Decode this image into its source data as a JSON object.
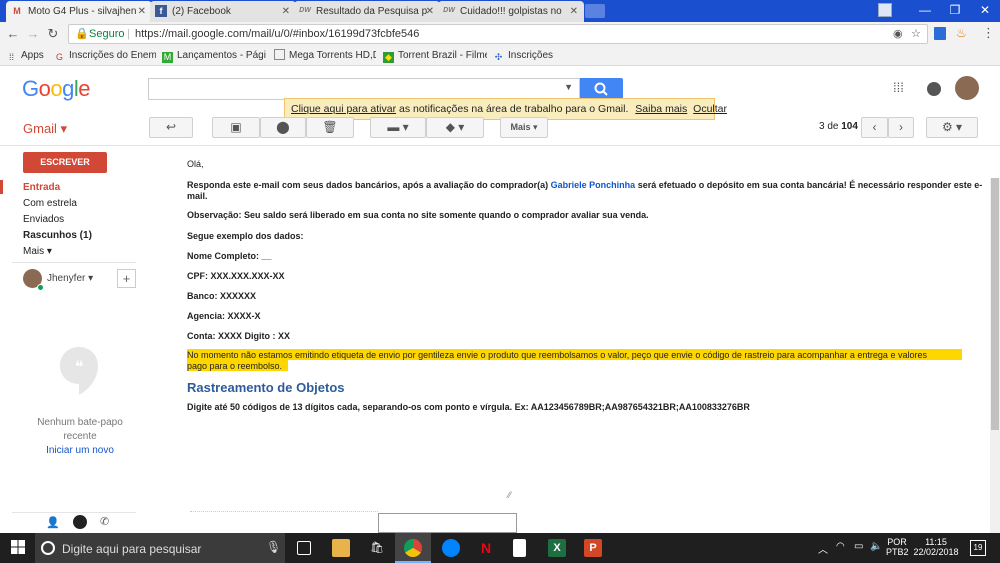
{
  "browser": {
    "tabs": [
      {
        "label": "Moto G4 Plus - silvajhen",
        "icon": "M"
      },
      {
        "label": "(2) Facebook",
        "icon": "f"
      },
      {
        "label": "Resultado da Pesquisa p",
        "icon": "DW"
      },
      {
        "label": "Cuidado!!! golpistas no",
        "icon": "DW"
      }
    ],
    "secure_label": "Seguro",
    "url": "https://mail.google.com/mail/u/0/#inbox/16199d73fcbfe546",
    "bookmarks": [
      {
        "label": "Apps"
      },
      {
        "label": "Inscrições do Enem 2"
      },
      {
        "label": "Lançamentos - Págin"
      },
      {
        "label": "Mega Torrents HD,Do"
      },
      {
        "label": "Torrent Brazil - Filme"
      },
      {
        "label": "Inscrições"
      }
    ]
  },
  "gmail": {
    "logo": "Google",
    "product": "Gmail ▾",
    "notification": {
      "link_text": "Clique aqui para ativar",
      "rest_text": "as notificações na área de trabalho para o Gmail.",
      "learn_more": "Saiba mais",
      "hide": "Ocultar"
    },
    "toolbar": {
      "more_label": "Mais ▾"
    },
    "pagination": {
      "current": "3",
      "of": "de",
      "total": "104"
    },
    "sidebar": {
      "compose": "ESCREVER",
      "items": [
        {
          "label": "Entrada"
        },
        {
          "label": "Com estrela"
        },
        {
          "label": "Enviados"
        },
        {
          "label": "Rascunhos (1)"
        },
        {
          "label": "Mais ▾"
        }
      ],
      "user": "Jhenyfer ▾",
      "chat_empty_line1": "Nenhum bate-papo",
      "chat_empty_line2": "recente",
      "start_new": "Iniciar um novo"
    },
    "message": {
      "greeting": "Olá,",
      "para1_a": "Responda este e-mail com seus dados bancários, após a avaliação do comprador(a)",
      "para1_name": "Gabriele Ponchinha",
      "para1_b": "será efetuado o depósito em sua conta bancária! É necessário responder este e-",
      "para1_c": "mail.",
      "para2": "Observação: Seu saldo será liberado em sua conta no site somente quando o comprador avaliar sua venda.",
      "para3": "Segue exemplo dos dados:",
      "field_name": "Nome Completo: __",
      "field_cpf": "CPF: XXX.XXX.XXX-XX",
      "field_bank": "Banco: XXXXXX",
      "field_agency": "Agencia: XXXX-X",
      "field_account": "Conta: XXXX Digito : XX",
      "highlight_1": "No momento não estamos emitindo etiqueta de envio por gentileza envie o produto que reembolsamos o valor, peço que envie o código de rastreio para acompanhar a entrega e valores",
      "highlight_2": "pago para o reembolso.",
      "tracking_title": "Rastreamento de Objetos",
      "tracking_text": "Digite até 50 códigos de 13 dígitos cada, separando-os com ponto e vírgula. Ex: AA123456789BR;AA987654321BR;AA100833276BR"
    }
  },
  "taskbar": {
    "search_placeholder": "Digite aqui para pesquisar",
    "lang": "POR",
    "layout": "PTB2",
    "time": "11:15",
    "date": "22/02/2018",
    "notification_count": "19"
  },
  "colors": {
    "gmail_red": "#d14836",
    "link_blue": "#1155cc",
    "highlight": "#ffd700",
    "search_blue": "#4285f4",
    "tracking_blue": "#2e5c9a"
  }
}
